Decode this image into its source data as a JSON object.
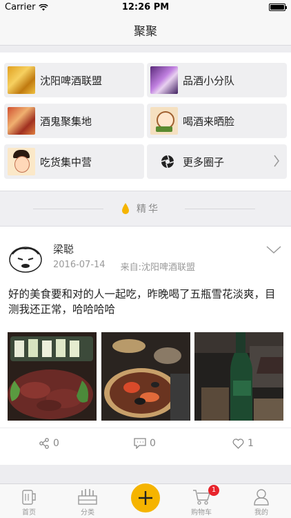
{
  "status_bar": {
    "carrier": "Carrier",
    "time": "12:26 PM"
  },
  "nav": {
    "title": "聚聚"
  },
  "circles": [
    {
      "label": "沈阳啤酒联盟",
      "icon": "beer-group-thumbnail"
    },
    {
      "label": "品酒小分队",
      "icon": "wine-group-thumbnail"
    },
    {
      "label": "酒鬼聚集地",
      "icon": "party-group-thumbnail"
    },
    {
      "label": "喝酒来晒脸",
      "icon": "cartoon-face-thumbnail"
    },
    {
      "label": "吃货集中营",
      "icon": "foodie-cartoon-thumbnail"
    },
    {
      "label": "更多圈子",
      "icon": "aperture-icon"
    }
  ],
  "section": {
    "title": "精华",
    "icon": "drop-icon",
    "accent": "#f5b400"
  },
  "post": {
    "username": "梁聪",
    "date": "2016-07-14",
    "source": "来自:沈阳啤酒联盟",
    "text": "好的美食要和对的人一起吃，昨晚喝了五瓶雪花淡爽，目测我还正常，哈哈哈哈",
    "photos": [
      "grilled-meat-photo",
      "seafood-pot-photo",
      "beer-bottle-photo"
    ],
    "share_count": "0",
    "comment_count": "0",
    "like_count": "1"
  },
  "tabbar": {
    "items": [
      {
        "label": "首页",
        "icon": "beer-mug-icon"
      },
      {
        "label": "分类",
        "icon": "beer-crate-icon"
      },
      {
        "label": "购物车",
        "icon": "cart-icon"
      },
      {
        "label": "我的",
        "icon": "user-icon"
      }
    ],
    "cart_badge": "1",
    "plus_color": "#f5b400"
  }
}
